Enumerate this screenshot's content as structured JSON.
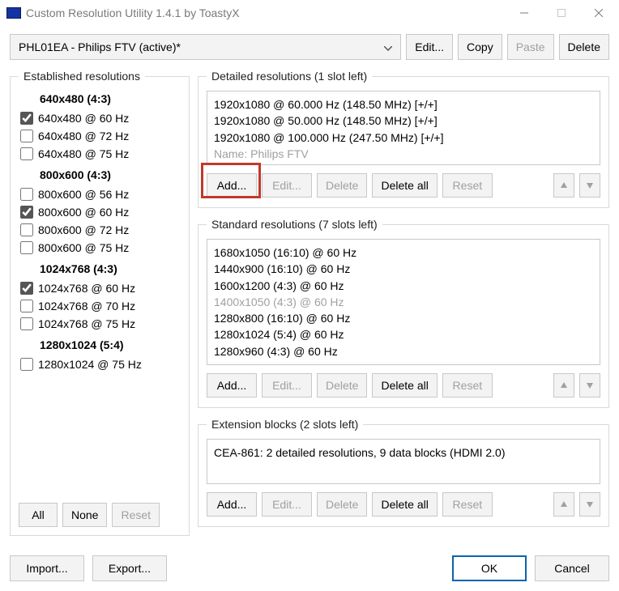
{
  "window": {
    "title": "Custom Resolution Utility 1.4.1 by ToastyX"
  },
  "top": {
    "dropdown": "PHL01EA - Philips FTV (active)*",
    "edit": "Edit...",
    "copy": "Copy",
    "paste": "Paste",
    "delete": "Delete"
  },
  "established": {
    "legend": "Established resolutions",
    "g1": {
      "head": "640x480 (4:3)",
      "i1": "640x480 @ 60 Hz",
      "i2": "640x480 @ 72 Hz",
      "i3": "640x480 @ 75 Hz"
    },
    "g2": {
      "head": "800x600 (4:3)",
      "i1": "800x600 @ 56 Hz",
      "i2": "800x600 @ 60 Hz",
      "i3": "800x600 @ 72 Hz",
      "i4": "800x600 @ 75 Hz"
    },
    "g3": {
      "head": "1024x768 (4:3)",
      "i1": "1024x768 @ 60 Hz",
      "i2": "1024x768 @ 70 Hz",
      "i3": "1024x768 @ 75 Hz"
    },
    "g4": {
      "head": "1280x1024 (5:4)",
      "i1": "1280x1024 @ 75 Hz"
    },
    "all": "All",
    "none": "None",
    "reset": "Reset"
  },
  "detailed": {
    "legend": "Detailed resolutions (1 slot left)",
    "items": {
      "r1": "1920x1080 @ 60.000 Hz (148.50 MHz) [+/+]",
      "r2": "1920x1080 @ 50.000 Hz (148.50 MHz) [+/+]",
      "r3": "1920x1080 @ 100.000 Hz (247.50 MHz) [+/+]",
      "r4": "Name: Philips FTV"
    },
    "add": "Add...",
    "edit": "Edit...",
    "delete": "Delete",
    "deleteall": "Delete all",
    "reset": "Reset"
  },
  "standard": {
    "legend": "Standard resolutions (7 slots left)",
    "items": {
      "r1": "1680x1050 (16:10) @ 60 Hz",
      "r2": "1440x900 (16:10) @ 60 Hz",
      "r3": "1600x1200 (4:3) @ 60 Hz",
      "r4": "1400x1050 (4:3) @ 60 Hz",
      "r5": "1280x800 (16:10) @ 60 Hz",
      "r6": "1280x1024 (5:4) @ 60 Hz",
      "r7": "1280x960 (4:3) @ 60 Hz"
    },
    "add": "Add...",
    "edit": "Edit...",
    "delete": "Delete",
    "deleteall": "Delete all",
    "reset": "Reset"
  },
  "ext": {
    "legend": "Extension blocks (2 slots left)",
    "items": {
      "r1": "CEA-861: 2 detailed resolutions, 9 data blocks (HDMI 2.0)"
    },
    "add": "Add...",
    "edit": "Edit...",
    "delete": "Delete",
    "deleteall": "Delete all",
    "reset": "Reset"
  },
  "bottom": {
    "import": "Import...",
    "export": "Export...",
    "ok": "OK",
    "cancel": "Cancel"
  }
}
